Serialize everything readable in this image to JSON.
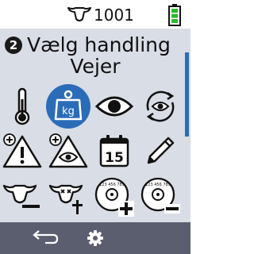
{
  "status": {
    "animal_icon": "cow-head-icon",
    "animal_id": "1001",
    "battery_icon": "battery-full-icon",
    "battery_color": "#2db82d"
  },
  "header": {
    "step_number": "2",
    "title": "Vælg handling",
    "subtitle": "Vejer"
  },
  "actions": [
    {
      "icon": "thermometer-icon",
      "selected": false
    },
    {
      "icon": "weigh-kg-icon",
      "label": "kg",
      "selected": true
    },
    {
      "icon": "eye-icon",
      "selected": false
    },
    {
      "icon": "eye-cycle-icon",
      "selected": false
    },
    {
      "icon": "add-warning-icon",
      "selected": false
    },
    {
      "icon": "add-observation-icon",
      "selected": false
    },
    {
      "icon": "calendar-icon",
      "label": "15",
      "selected": false
    },
    {
      "icon": "pencil-icon",
      "selected": false
    },
    {
      "icon": "remove-animal-icon",
      "selected": false
    },
    {
      "icon": "dead-animal-icon",
      "selected": false
    },
    {
      "icon": "add-tag-icon",
      "label": "123 456 789",
      "selected": false
    },
    {
      "icon": "remove-tag-icon",
      "label": "123 456 789",
      "selected": false
    }
  ],
  "colors": {
    "content_background": "#d9dde6",
    "selected_accent": "#2b6cb8",
    "bottom_bar": "#5b5e6f"
  },
  "footer": {
    "back_icon": "back-arrow-icon",
    "settings_icon": "gear-icon"
  }
}
